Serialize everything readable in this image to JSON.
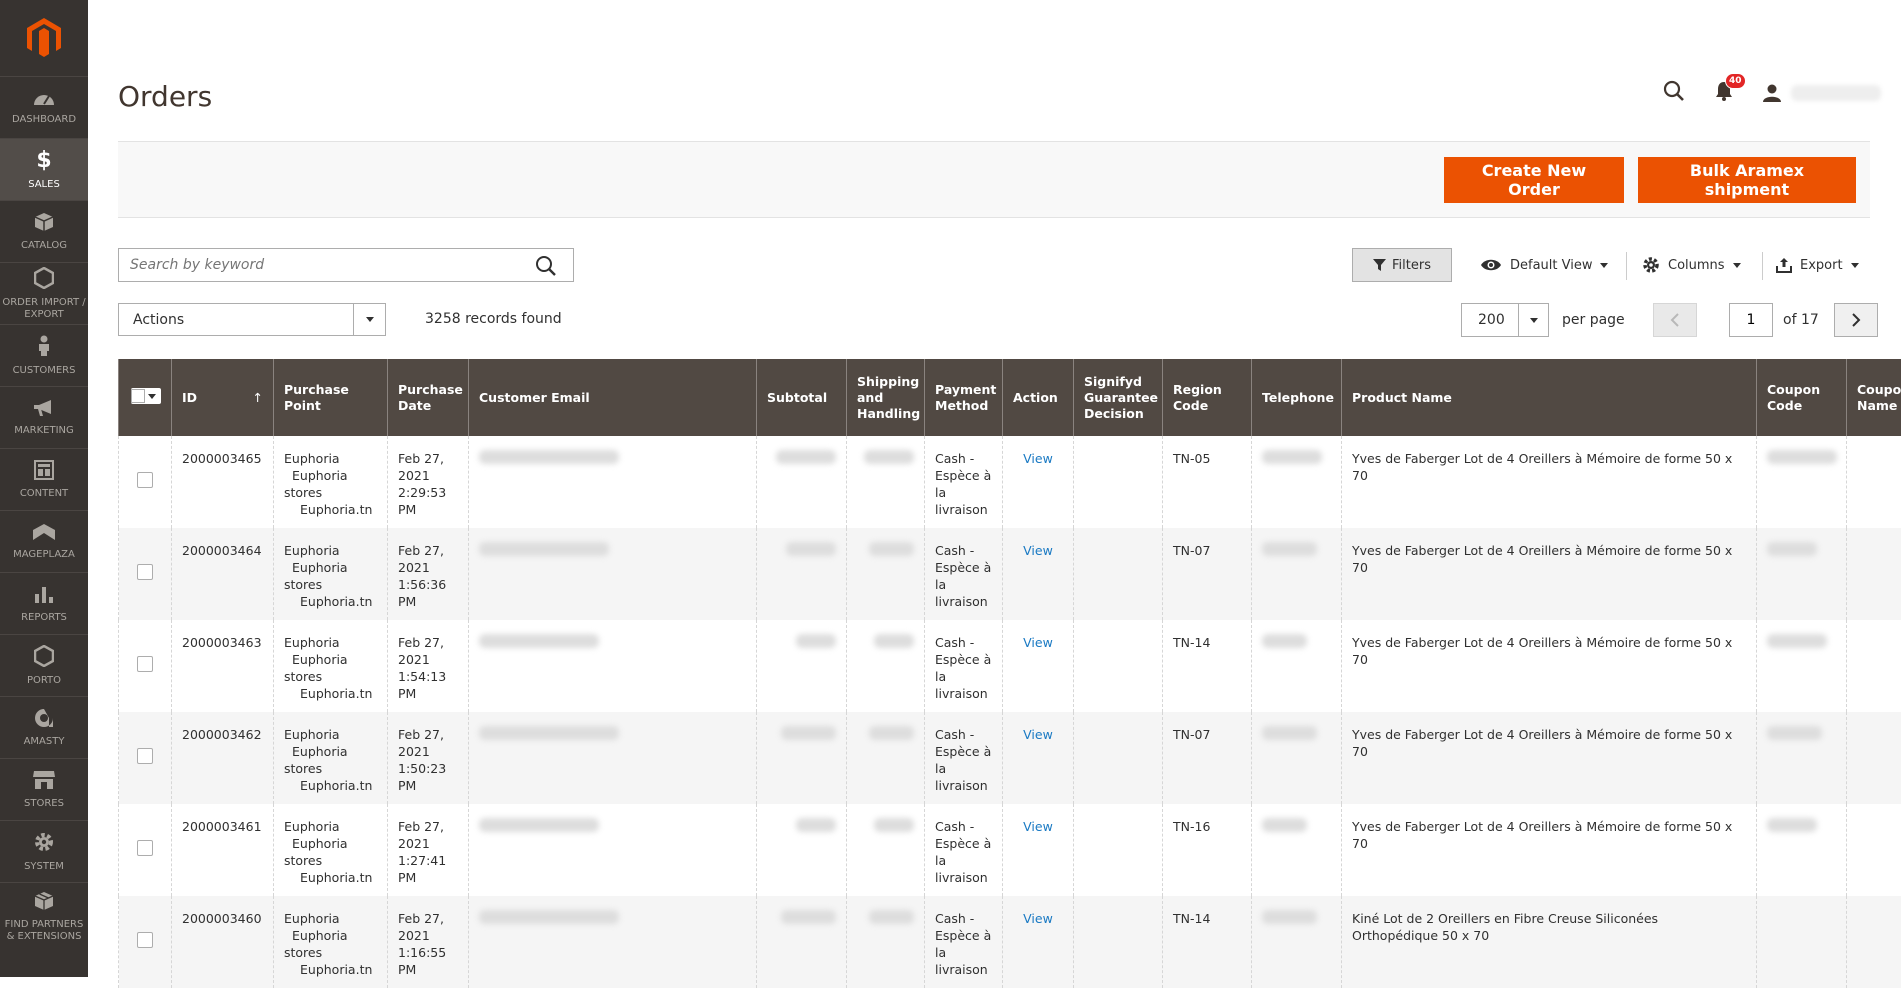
{
  "sidebar": {
    "items": [
      {
        "label": "DASHBOARD",
        "icon": "dashboard-icon"
      },
      {
        "label": "SALES",
        "icon": "dollar-icon",
        "active": true
      },
      {
        "label": "CATALOG",
        "icon": "box-icon"
      },
      {
        "label": "ORDER IMPORT / EXPORT",
        "icon": "hexagon-icon"
      },
      {
        "label": "CUSTOMERS",
        "icon": "person-icon"
      },
      {
        "label": "MARKETING",
        "icon": "megaphone-icon"
      },
      {
        "label": "CONTENT",
        "icon": "layout-icon"
      },
      {
        "label": "MAGEPLAZA",
        "icon": "mageplaza-icon"
      },
      {
        "label": "REPORTS",
        "icon": "bar-chart-icon"
      },
      {
        "label": "PORTO",
        "icon": "hexagon-icon"
      },
      {
        "label": "AMASTY",
        "icon": "amasty-icon"
      },
      {
        "label": "STORES",
        "icon": "store-icon"
      },
      {
        "label": "SYSTEM",
        "icon": "gear-icon"
      },
      {
        "label": "FIND PARTNERS & EXTENSIONS",
        "icon": "cubes-icon"
      }
    ]
  },
  "header": {
    "title": "Orders",
    "notification_count": "40"
  },
  "actions_bar": {
    "create_label": "Create New Order",
    "bulk_label": "Bulk Aramex shipment"
  },
  "toolbar": {
    "search_placeholder": "Search by keyword",
    "filters_label": "Filters",
    "default_view_label": "Default View",
    "columns_label": "Columns",
    "export_label": "Export",
    "actions_label": "Actions",
    "records_found": "3258 records found",
    "per_page_value": "200",
    "per_page_label": "per page",
    "current_page": "1",
    "total_pages": "of 17"
  },
  "colors": {
    "accent": "#eb5202",
    "sidebar_bg": "#373330",
    "header_bg": "#514943",
    "link": "#1979c3"
  },
  "grid": {
    "columns": [
      "ID",
      "Purchase Point",
      "Purchase Date",
      "Customer Email",
      "Subtotal",
      "Shipping and Handling",
      "Payment Method",
      "Action",
      "Signifyd Guarantee Decision",
      "Region Code",
      "Telephone",
      "Product Name",
      "Coupon Code",
      "Coupon Rule Name"
    ],
    "sort_indicator": "↑",
    "rows": [
      {
        "id": "2000003465",
        "purchase_point": [
          "Euphoria",
          "Euphoria",
          "stores",
          "Euphoria.tn"
        ],
        "date": [
          "Feb 27,",
          "2021",
          "2:29:53",
          "PM"
        ],
        "payment": [
          "Cash -",
          "Espèce à",
          "la",
          "livraison"
        ],
        "action": "View",
        "region": "TN-05",
        "product": "Yves de Faberger Lot de 4 Oreillers à Mémoire de forme 50 x 70"
      },
      {
        "id": "2000003464",
        "purchase_point": [
          "Euphoria",
          "Euphoria",
          "stores",
          "Euphoria.tn"
        ],
        "date": [
          "Feb 27,",
          "2021",
          "1:56:36",
          "PM"
        ],
        "payment": [
          "Cash -",
          "Espèce à",
          "la",
          "livraison"
        ],
        "action": "View",
        "region": "TN-07",
        "product": "Yves de Faberger Lot de 4 Oreillers à Mémoire de forme 50 x 70"
      },
      {
        "id": "2000003463",
        "purchase_point": [
          "Euphoria",
          "Euphoria",
          "stores",
          "Euphoria.tn"
        ],
        "date": [
          "Feb 27,",
          "2021",
          "1:54:13",
          "PM"
        ],
        "payment": [
          "Cash -",
          "Espèce à",
          "la",
          "livraison"
        ],
        "action": "View",
        "region": "TN-14",
        "product": "Yves de Faberger Lot de 4 Oreillers à Mémoire de forme 50 x 70"
      },
      {
        "id": "2000003462",
        "purchase_point": [
          "Euphoria",
          "Euphoria",
          "stores",
          "Euphoria.tn"
        ],
        "date": [
          "Feb 27,",
          "2021",
          "1:50:23",
          "PM"
        ],
        "payment": [
          "Cash -",
          "Espèce à",
          "la",
          "livraison"
        ],
        "action": "View",
        "region": "TN-07",
        "product": "Yves de Faberger Lot de 4 Oreillers à Mémoire de forme 50 x 70"
      },
      {
        "id": "2000003461",
        "purchase_point": [
          "Euphoria",
          "Euphoria",
          "stores",
          "Euphoria.tn"
        ],
        "date": [
          "Feb 27,",
          "2021",
          "1:27:41",
          "PM"
        ],
        "payment": [
          "Cash -",
          "Espèce à",
          "la",
          "livraison"
        ],
        "action": "View",
        "region": "TN-16",
        "product": "Yves de Faberger Lot de 4 Oreillers à Mémoire de forme 50 x 70"
      },
      {
        "id": "2000003460",
        "purchase_point": [
          "Euphoria",
          "Euphoria",
          "stores",
          "Euphoria.tn"
        ],
        "date": [
          "Feb 27,",
          "2021",
          "1:16:55",
          "PM"
        ],
        "payment": [
          "Cash -",
          "Espèce à",
          "la",
          "livraison"
        ],
        "action": "View",
        "region": "TN-14",
        "product": "Kiné Lot de 2 Oreillers en Fibre Creuse Siliconées Orthopédique 50 x 70"
      }
    ]
  }
}
